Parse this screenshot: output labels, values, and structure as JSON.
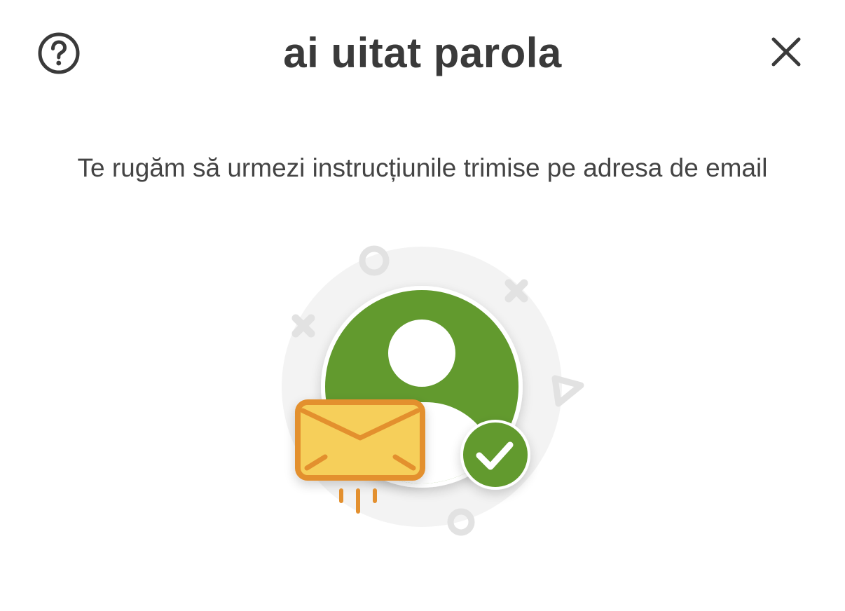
{
  "header": {
    "title": "ai uitat parola",
    "help_icon": "help-circle-icon",
    "close_icon": "close-icon"
  },
  "main": {
    "message": "Te rugăm să urmezi instrucțiunile trimise pe adresa de email"
  },
  "illustration": {
    "icons": [
      "user-avatar-icon",
      "envelope-icon",
      "check-badge-icon"
    ],
    "colors": {
      "avatar_green": "#629a2e",
      "envelope_fill": "#f6cf5a",
      "envelope_stroke": "#e3902f",
      "decor_gray": "#e3e3e3",
      "backdrop_gray": "#f3f3f3"
    }
  }
}
